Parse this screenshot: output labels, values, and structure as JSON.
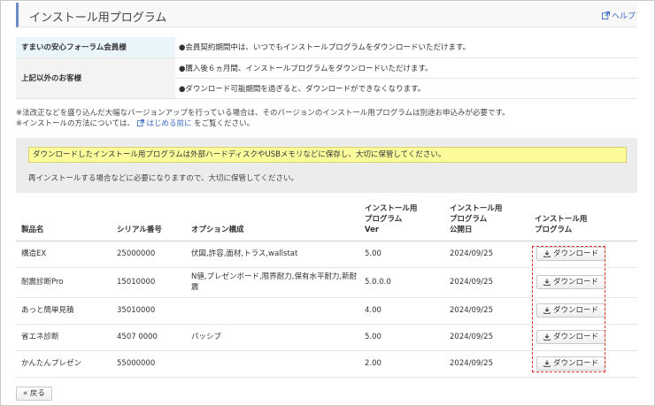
{
  "header": {
    "title": "インストール用プログラム",
    "help_label": "ヘルプ"
  },
  "info": {
    "rows": [
      {
        "label": "すまいの安心フォーラム会員様",
        "value": "●会員契約期間中は、いつでもインストールプログラムをダウンロードいただけます。"
      },
      {
        "label": "上記以外のお客様",
        "values": [
          "●購入後６ヵ月間、インストールプログラムをダウンロードいただけます。",
          "●ダウンロード可能期間を過ぎると、ダウンロードができなくなります。"
        ]
      }
    ]
  },
  "notes": {
    "line1": "※法改正などを盛り込んだ大幅なバージョンアップを行っている場合は、そのバージョンのインストール用プログラムは別途お申込みが必要です。",
    "line2_prefix": "※インストールの方法については、",
    "line2_link": "はじめる前に",
    "line2_suffix": "をご覧ください。"
  },
  "notice": {
    "highlight": "ダウンロードしたインストール用プログラムは外部ハードディスクやUSBメモリなどに保存し、大切に保管してください。",
    "sub": "再インストールする場合などに必要になりますので、大切に保管してください。"
  },
  "table": {
    "headers": {
      "name": "製品名",
      "serial": "シリアル番号",
      "option": "オプション構成",
      "ver": [
        "インストール用",
        "プログラム",
        "Ver"
      ],
      "date": [
        "インストール用",
        "プログラム",
        "公開日"
      ],
      "program": [
        "インストール用",
        "プログラム"
      ]
    },
    "download_label": "ダウンロード",
    "rows": [
      {
        "name": "構造EX",
        "serial": "25000000",
        "option": "伏図,許容,面材,トラス,wallstat",
        "ver": "5.00",
        "date": "2024/09/25"
      },
      {
        "name": "耐震診断Pro",
        "serial": "15010000",
        "option": "N値,プレゼンボード,限界耐力,保有水平耐力,新耐震",
        "ver": "5.0.0.0",
        "date": "2024/09/25"
      },
      {
        "name": "あっと簡単見積",
        "serial": "35010000",
        "option": "",
        "ver": "4.00",
        "date": "2024/09/25"
      },
      {
        "name": "省エネ診断",
        "serial": "4507 0000",
        "option": "パッシブ",
        "ver": "5.00",
        "date": "2024/09/25"
      },
      {
        "name": "かんたんプレゼン",
        "serial": "55000000",
        "option": "",
        "ver": "2.00",
        "date": "2024/09/25"
      }
    ]
  },
  "footer": {
    "back_label": "« 戻る"
  },
  "colors": {
    "accent": "#6a8bc4",
    "link": "#3a6bc4",
    "highlight": "#fcfc9c",
    "marker": "#e0322e"
  },
  "icons": {
    "help": "external-link-icon",
    "download": "download-icon"
  }
}
